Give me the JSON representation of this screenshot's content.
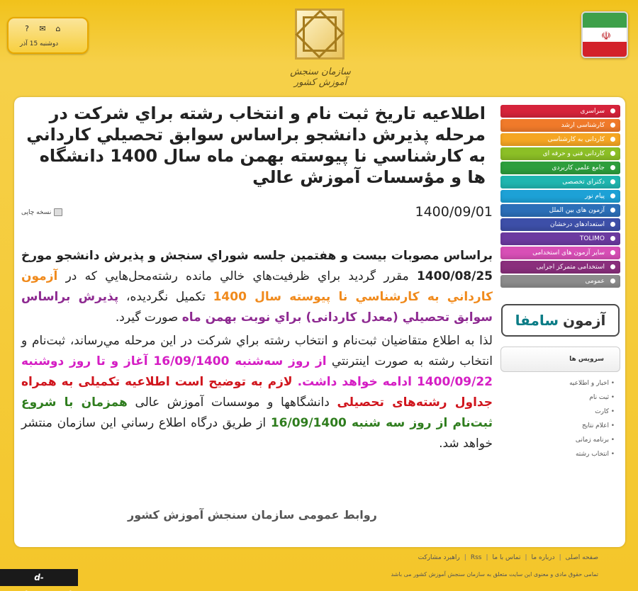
{
  "header": {
    "date": "دوشنبه 15 آذر",
    "icons": [
      "home-icon",
      "mail-icon",
      "help-icon"
    ],
    "logo_text": "سازمان سنجش آموزش کشور"
  },
  "article": {
    "title": "اطلاعيه تاريخ ثبت نام و انتخاب رشته براي شركت در مرحله پذيرش دانشجو براساس سوابق تحصيلي كارداني به كارشناسي نا پيوسته بهمن ماه سال 1400 دانشگاه ها و مؤسسات آموزش عالي",
    "print_label": "نسخه چاپی",
    "date": "1400/09/01",
    "p1": {
      "s1": "براساس مصوبات بيست و هفتمين جلسه شوراي سنجش و پذيرش دانشجو مورخ ",
      "s2": "1400/08/25",
      "s3": " مقرر گرديد براي ظرفيت‌هاي خالي مانده رشته‌محل‌هايي كه در ",
      "s4": "آزمون كارداني به كارشناسي نا پيوسته سال 1400",
      "s5": " تكميل نگرديده، ",
      "s6": "پذيرش براساس سوابق تحصيلي (معدل کاردانی) براي نوبت بهمن ماه",
      "s7": " صورت گيرد."
    },
    "p2": {
      "s1": "لذا به اطلاع متقاضيان ثبت‌نام و انتخاب رشته براي شركت در اين مرحله مي‌رساند، ثبت‌نام و انتخاب رشته به صورت اينترنتي ",
      "s2": "از روز سه‌شنبه 16/09/1400",
      "s3": " آغاز و تا روز دوشنبه ",
      "s4": "1400/09/22",
      "s5": " ادامه خواهد داشت. ",
      "s6": "لازم به توضیح است اطلاعیه تکمیلی به همراه جداول رشته‌های تحصیلی",
      "s7": " دانشگاهها و موسسات آموزش عالی ",
      "s8": "همزمان با شروع ثبت‌نام از روز سه شنبه 16/09/1400",
      "s9": " از طريق درگاه اطلاع رساني اين سازمان منتشر خواهد شد."
    },
    "signature": "روابط عمومی سازمان سنجش آموزش کشور"
  },
  "menu": {
    "items": [
      {
        "label": "سراسری",
        "color": "#d6233b"
      },
      {
        "label": "کارشناسی ارشد",
        "color": "#f07a2a"
      },
      {
        "label": "کاردانی به کارشناسی",
        "color": "#f5a623"
      },
      {
        "label": "کاردانی فنی و حرفه ای",
        "color": "#8cbf26"
      },
      {
        "label": "جامع علمی کاربردی",
        "color": "#2e9e3d"
      },
      {
        "label": "دکترای تخصصی",
        "color": "#1fb6b0"
      },
      {
        "label": "پیام نور",
        "color": "#1da1d6"
      },
      {
        "label": "آزمون های بین الملل",
        "color": "#2c6fb8"
      },
      {
        "label": "استعدادهای درخشان",
        "color": "#3d4fa8"
      },
      {
        "label": "TOLIMO",
        "color": "#6c3aa0"
      },
      {
        "label": "سایر آزمون های استخدامی",
        "color": "#d84fb6"
      },
      {
        "label": "استخدامی متمرکز اجرایی",
        "color": "#8a2f7c"
      },
      {
        "label": "عمومی",
        "color": "#8c8c8c"
      }
    ]
  },
  "samfa": {
    "part1": "آزمون",
    "part2": "سامفا"
  },
  "services": {
    "title": "سرویس ها",
    "items": [
      "اخبار و اطلاعیه",
      "ثبت نام",
      "کارت",
      "اعلام نتایج",
      "برنامه زمانی",
      "انتخاب رشته"
    ]
  },
  "footer": {
    "links": [
      "صفحه اصلی",
      "درباره ما",
      "تماس با ما",
      "Rss",
      "راهبرد مشارکت"
    ],
    "copyright": "تمامی حقوق مادی و معنوی این سایت متعلق به سازمان سنجش آموزش کشور می باشد",
    "watermark": "d-neyriz.tvu.ac.ir"
  }
}
